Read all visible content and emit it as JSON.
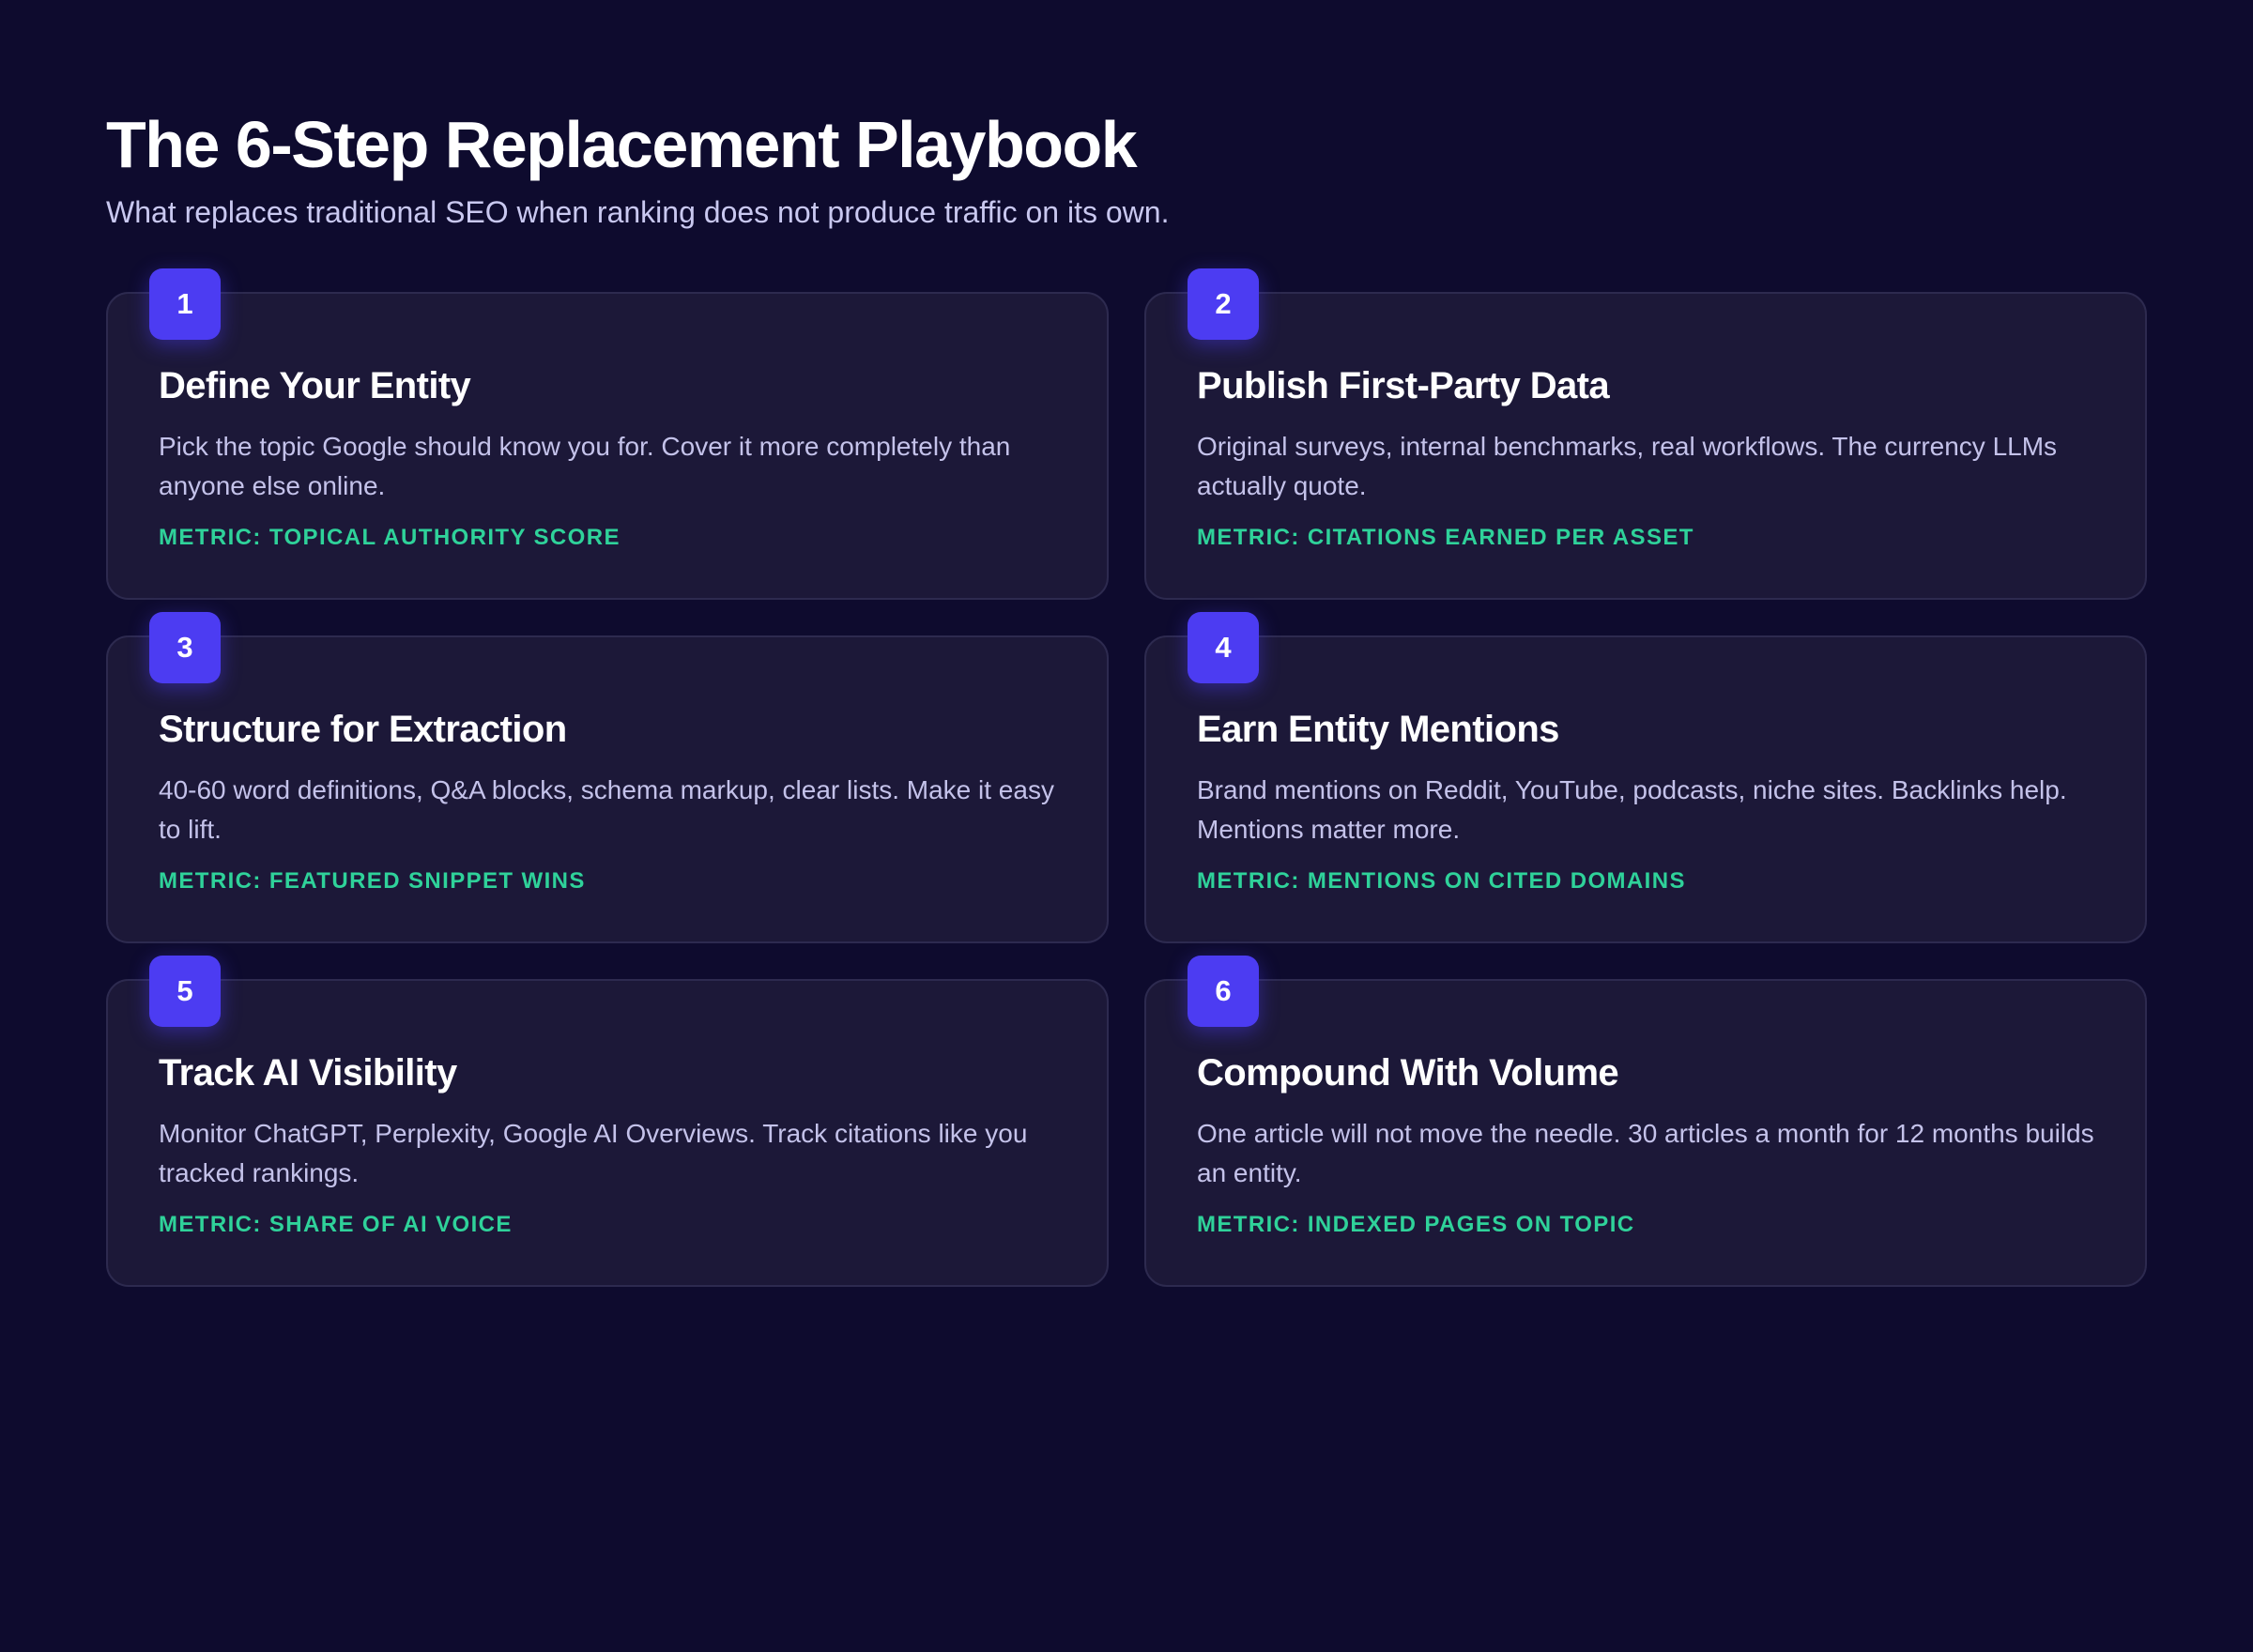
{
  "header": {
    "title": "The 6-Step Replacement Playbook",
    "subtitle": "What replaces traditional SEO when ranking does not produce traffic on its own."
  },
  "colors": {
    "background": "#0e0b2e",
    "card": "#1c1838",
    "badge": "#4c3cf2",
    "metric": "#2fd29a"
  },
  "steps": [
    {
      "number": "1",
      "title": "Define Your Entity",
      "description": "Pick the topic Google should know you for. Cover it more completely than anyone else online.",
      "metric": "METRIC: TOPICAL AUTHORITY SCORE"
    },
    {
      "number": "2",
      "title": "Publish First-Party Data",
      "description": "Original surveys, internal benchmarks, real workflows. The currency LLMs actually quote.",
      "metric": "METRIC: CITATIONS EARNED PER ASSET"
    },
    {
      "number": "3",
      "title": "Structure for Extraction",
      "description": "40-60 word definitions, Q&A blocks, schema markup, clear lists. Make it easy to lift.",
      "metric": "METRIC: FEATURED SNIPPET WINS"
    },
    {
      "number": "4",
      "title": "Earn Entity Mentions",
      "description": "Brand mentions on Reddit, YouTube, podcasts, niche sites. Backlinks help. Mentions matter more.",
      "metric": "METRIC: MENTIONS ON CITED DOMAINS"
    },
    {
      "number": "5",
      "title": "Track AI Visibility",
      "description": "Monitor ChatGPT, Perplexity, Google AI Overviews. Track citations like you tracked rankings.",
      "metric": "METRIC: SHARE OF AI VOICE"
    },
    {
      "number": "6",
      "title": "Compound With Volume",
      "description": "One article will not move the needle. 30 articles a month for 12 months builds an entity.",
      "metric": "METRIC: INDEXED PAGES ON TOPIC"
    }
  ]
}
